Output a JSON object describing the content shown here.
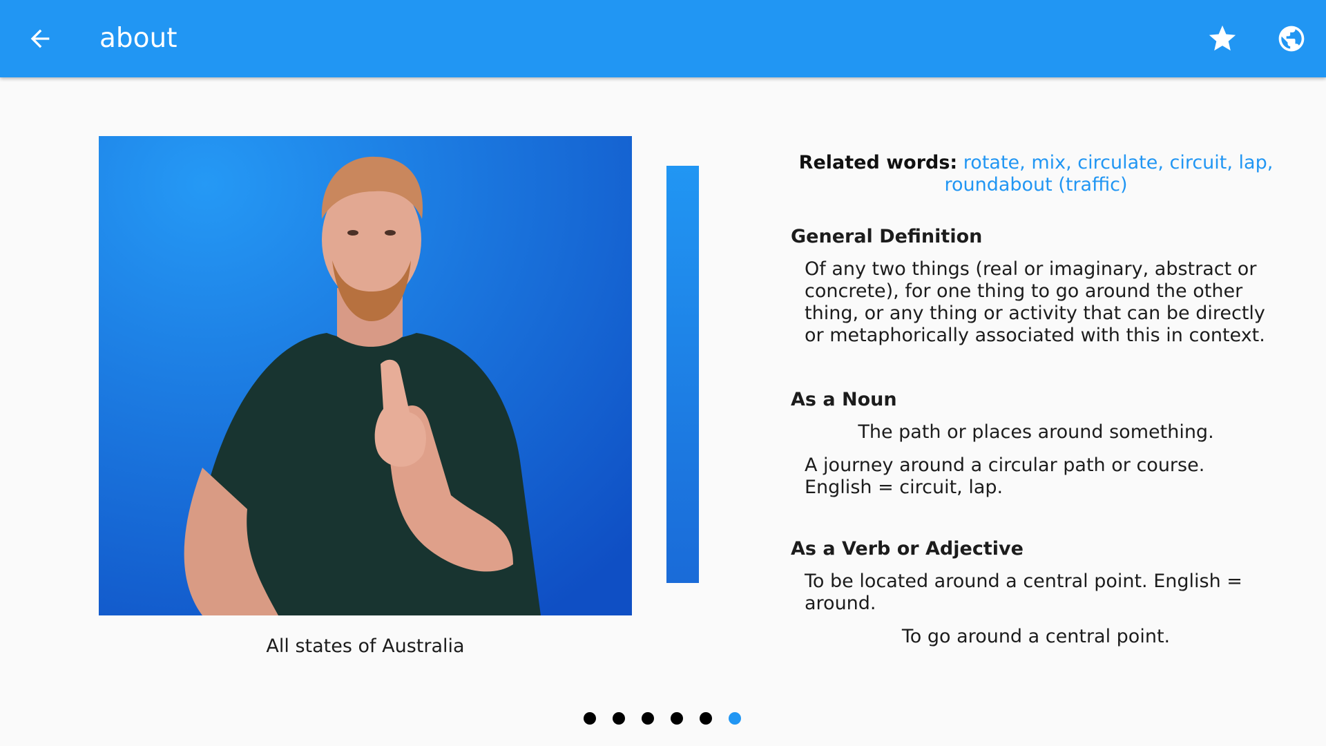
{
  "appbar": {
    "title": "about",
    "background": "#2196f3",
    "icons": [
      "arrow-back-icon",
      "star-icon",
      "globe-icon"
    ]
  },
  "video": {
    "caption": "All states of Australia"
  },
  "related": {
    "label": "Related words:",
    "words": "rotate, mix, circulate, circuit, lap, roundabout (traffic)"
  },
  "sections": [
    {
      "title": "General Definition",
      "paras": [
        "Of any two things (real or imaginary, abstract or concrete), for one thing to go around the other thing, or any thing or activity that can be directly or metaphorically associated with this in context."
      ]
    },
    {
      "title": "As a Noun",
      "paras": [
        "The path or places around something.",
        "A journey around a circular path or course. English = circuit, lap."
      ]
    },
    {
      "title": "As a Verb or Adjective",
      "paras": [
        "To be located around a central point. English = around.",
        "To go around a central point."
      ]
    }
  ],
  "pager": {
    "count": 6,
    "active_index": 5,
    "active_color": "#2196f3"
  }
}
